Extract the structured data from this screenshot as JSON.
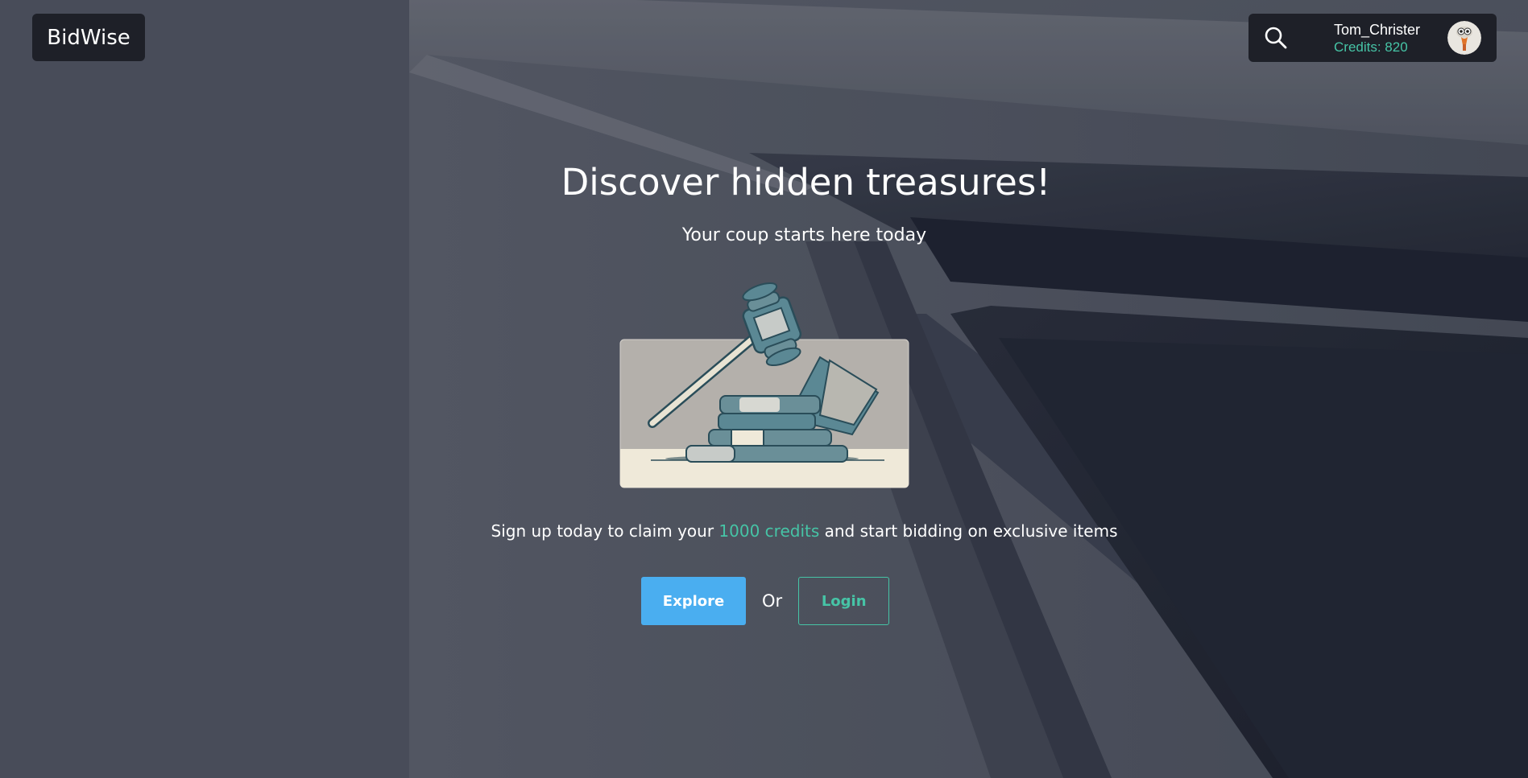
{
  "header": {
    "logo_text": "BidWise",
    "user": {
      "username": "Tom_Christer",
      "credits_text": "Credits: 820"
    }
  },
  "hero": {
    "title": "Discover hidden treasures!",
    "subtitle": "Your coup starts here today",
    "signup": {
      "prefix": "Sign up today to claim your",
      "highlight": "1000 credits",
      "suffix": "and start bidding on exclusive items"
    },
    "actions": {
      "explore_label": "Explore",
      "or_label": "Or",
      "login_label": "Login"
    }
  },
  "icons": {
    "search": "search-icon",
    "avatar": "user-avatar",
    "illustration": "gavel-illustration"
  },
  "colors": {
    "accent": "#46c4a6",
    "primary_button": "#4aaef0",
    "panel": "#1e2028",
    "text": "#ffffff"
  }
}
